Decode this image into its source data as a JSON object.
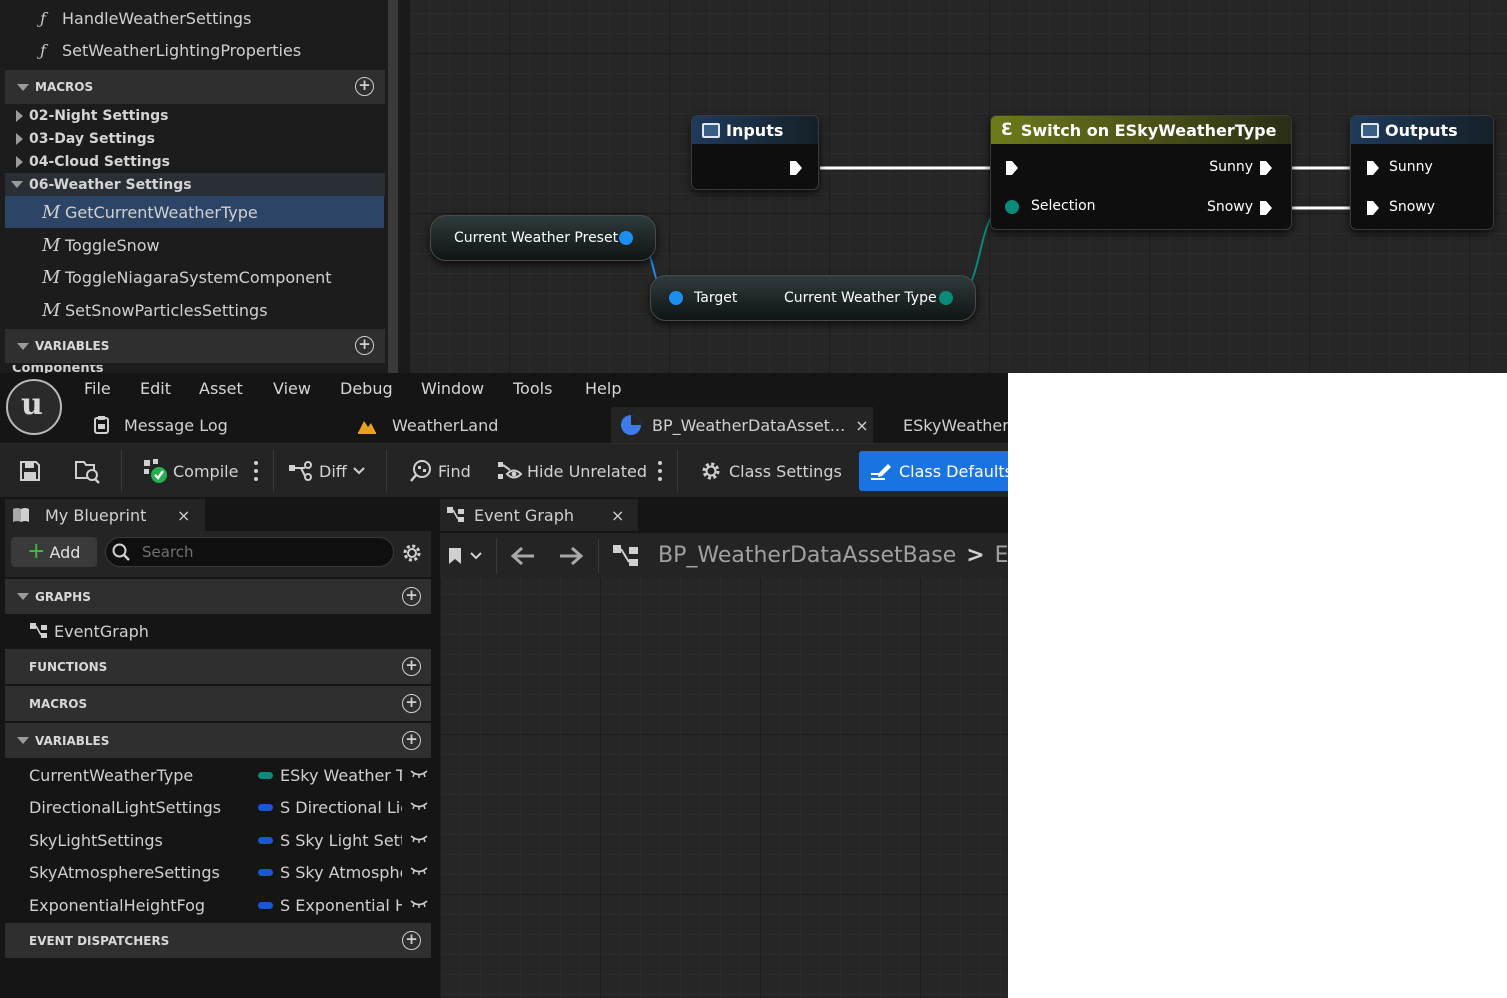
{
  "top_panel": {
    "functions": [
      "HandleWeatherSettings",
      "SetWeatherLightingProperties"
    ],
    "macros_header": "MACROS",
    "macro_groups": [
      "02-Night Settings",
      "03-Day Settings",
      "04-Cloud Settings",
      "06-Weather Settings"
    ],
    "macro_items": [
      "GetCurrentWeatherType",
      "ToggleSnow",
      "ToggleNiagaraSystemComponent",
      "SetSnowParticlesSettings"
    ],
    "variables_header": "VARIABLES",
    "cut_off_item": "Components"
  },
  "graph_nodes": {
    "inputs_title": "Inputs",
    "switch_title": "Switch on ESkyWeatherType",
    "switch_selection": "Selection",
    "switch_out_1": "Sunny",
    "switch_out_2": "Snowy",
    "outputs_title": "Outputs",
    "outputs_in_1": "Sunny",
    "outputs_in_2": "Snowy",
    "preset_var": "Current Weather Preset",
    "getter_target": "Target",
    "getter_output": "Current Weather Type"
  },
  "menu": [
    "File",
    "Edit",
    "Asset",
    "View",
    "Debug",
    "Window",
    "Tools",
    "Help"
  ],
  "tabs": {
    "message_log": "Message Log",
    "weatherland": "WeatherLand",
    "bp_asset": "BP_WeatherDataAsset...",
    "close": "×",
    "esky": "ESkyWeatherType"
  },
  "toolbar": {
    "compile": "Compile",
    "diff": "Diff",
    "find": "Find",
    "hide_unrelated": "Hide Unrelated",
    "class_settings": "Class Settings",
    "class_defaults": "Class Defaults"
  },
  "my_blueprint": {
    "tab": "My Blueprint",
    "add": "Add",
    "search_placeholder": "Search",
    "graphs": "GRAPHS",
    "event_graph": "EventGraph",
    "functions": "FUNCTIONS",
    "macros": "MACROS",
    "variables": "VARIABLES",
    "event_dispatchers": "EVENT DISPATCHERS",
    "vars": [
      {
        "name": "CurrentWeatherType",
        "type": "ESky Weather Type",
        "color": "#0a8a7a"
      },
      {
        "name": "DirectionalLightSettings",
        "type": "S Directional Light Settings",
        "color": "#1858d8"
      },
      {
        "name": "SkyLightSettings",
        "type": "S Sky Light Settings",
        "color": "#1858d8"
      },
      {
        "name": "SkyAtmosphereSettings",
        "type": "S Sky Atmosphere Settings",
        "color": "#1858d8"
      },
      {
        "name": "ExponentialHeightFog",
        "type": "S Exponential Height Fog",
        "color": "#1858d8"
      }
    ]
  },
  "event_graph": {
    "tab": "Event Graph",
    "breadcrumb_root": "BP_WeatherDataAssetBase",
    "breadcrumb_sep": ">",
    "breadcrumb_leaf": "EventGraph"
  },
  "colors": {
    "selected_row": "#2c4566",
    "class_defaults_bg": "#1a73e0",
    "switch_header": "#6e7a1a",
    "io_header": "#1f3a5a",
    "pin_blue": "#1c8ef0",
    "pin_teal": "#0a8a7a"
  }
}
